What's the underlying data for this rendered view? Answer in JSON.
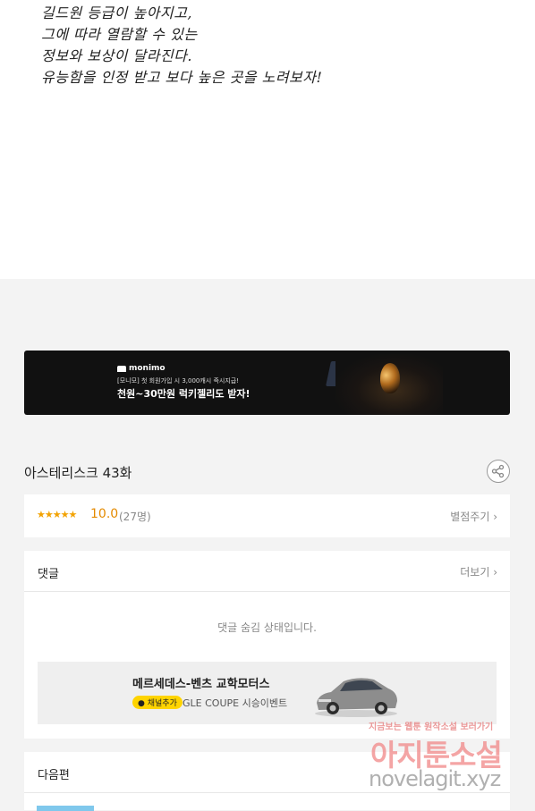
{
  "comic": {
    "lines": [
      "길드원 등급이 높아지고,",
      "그에 따라 열람할 수 있는",
      "정보와 보상이 달라진다.",
      "유능함을 인정 받고 보다 높은 곳을 노려보자!"
    ]
  },
  "ad_banner": {
    "brand": "monimo",
    "subtitle": "[모니모] 첫 회원가입 시 3,000캐시 즉시지급!",
    "headline": "천원~30만원 럭키젤리도 받자!"
  },
  "episode": {
    "title": "아스테리스크 43화",
    "share_icon": "share-icon"
  },
  "rating": {
    "stars": "★★★★★",
    "score": "10.0",
    "count": "(27명)",
    "rate_label": "별점주기 ›"
  },
  "comments": {
    "heading": "댓글",
    "more_label": "더보기 ›",
    "hidden_message": "댓글 숨김 상태입니다."
  },
  "car_ad": {
    "title": "메르세데스-벤츠 교학모터스",
    "chip": "채널추가",
    "description": "GLE COUPE 시승이벤트"
  },
  "next": {
    "heading": "다음편"
  },
  "watermark": {
    "top": "지금보는 웹툰 원작소설 보러가기",
    "middle": "아지툰소설",
    "url": "novelagit.xyz"
  },
  "colors": {
    "page_bg": "#f3f3f3",
    "star": "#f2a200",
    "score": "#e48a00",
    "chip": "#ffd400"
  }
}
